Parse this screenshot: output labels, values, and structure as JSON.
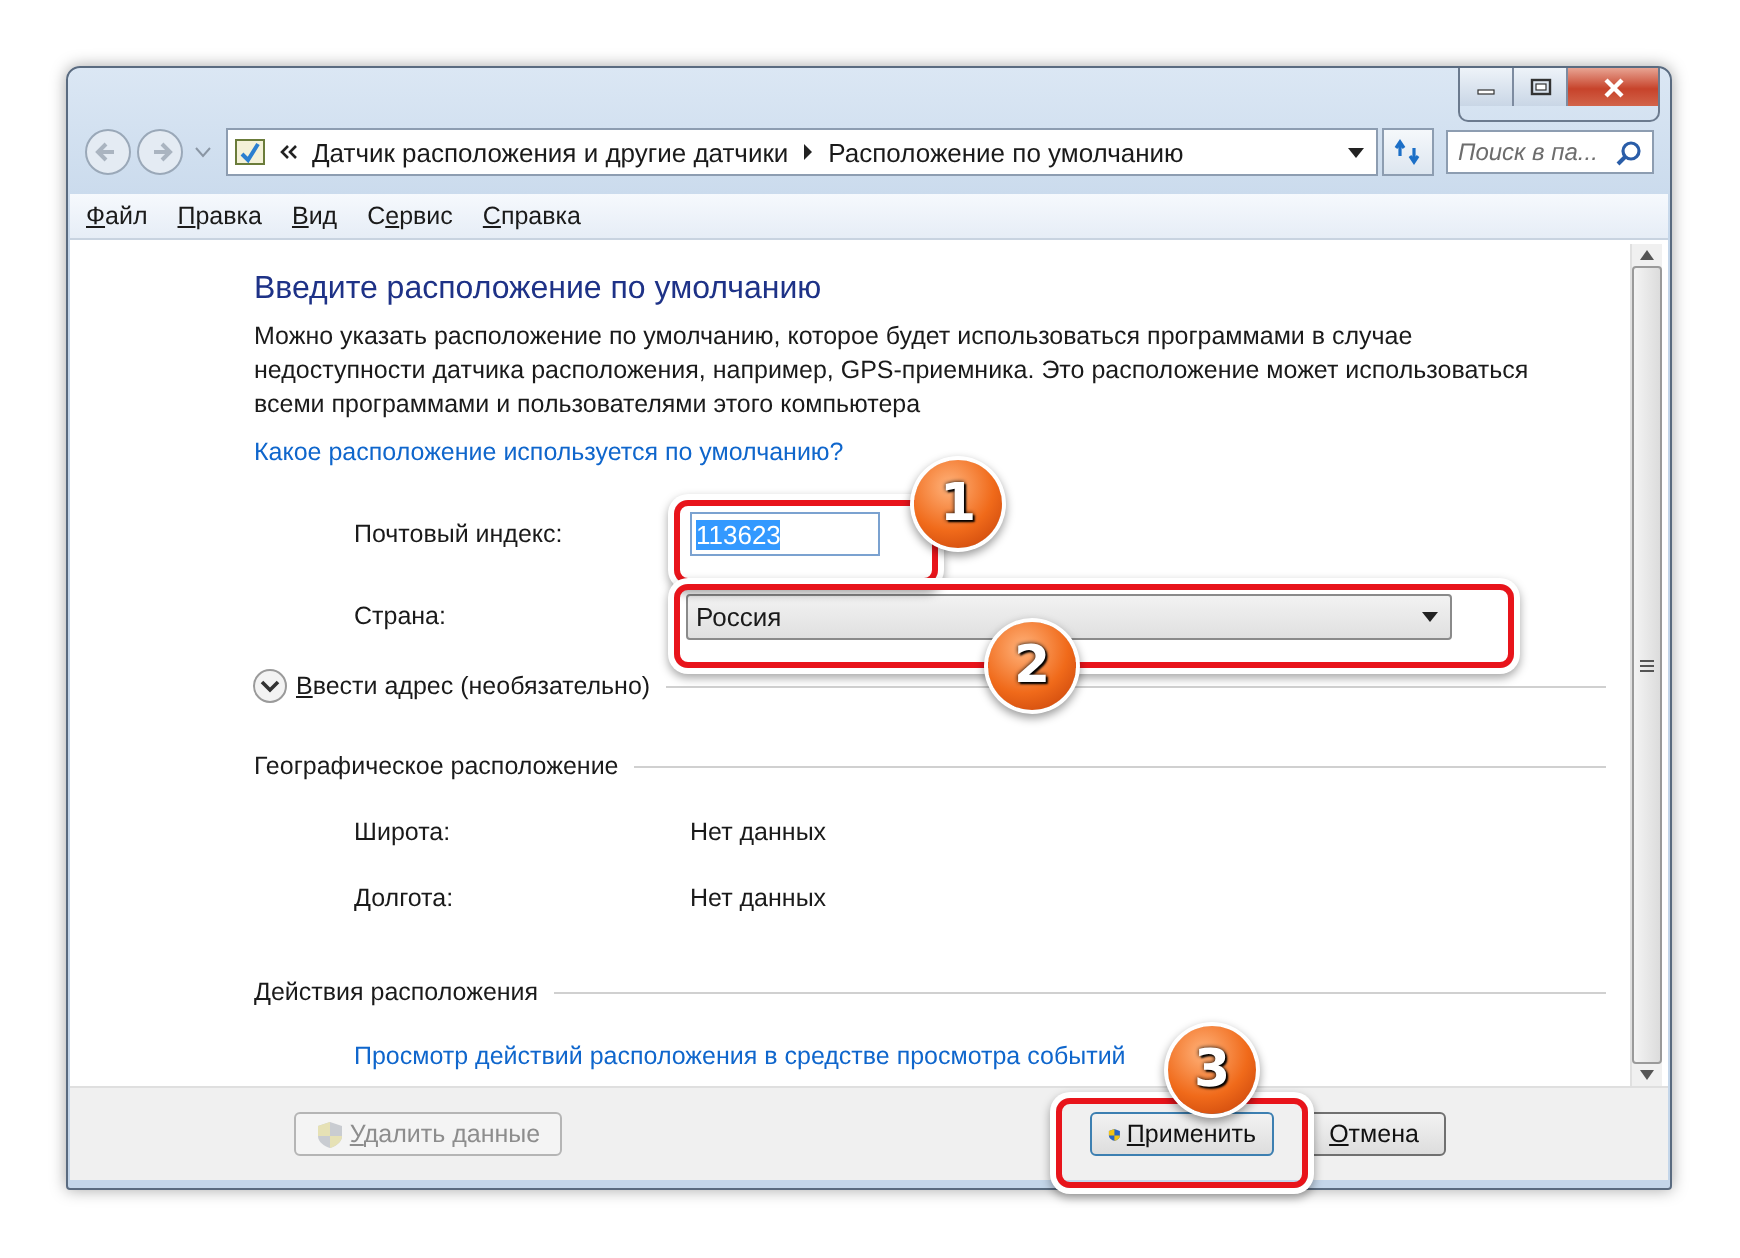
{
  "address_bar": {
    "breadcrumb": [
      "Датчик расположения и другие датчики",
      "Расположение по умолчанию"
    ],
    "search": {
      "placeholder": "Поиск в па..."
    }
  },
  "menu": [
    {
      "accel": "Ф",
      "after": "айл"
    },
    {
      "accel": "П",
      "after": "равка"
    },
    {
      "accel": "В",
      "after": "ид"
    },
    {
      "before": "С",
      "accel": "е",
      "after": "рвис"
    },
    {
      "accel": "С",
      "after": "правка"
    }
  ],
  "content": {
    "heading": "Введите расположение по умолчанию",
    "description": "Можно указать расположение по умолчанию, которое будет использоваться программами в случае недоступности датчика расположения, например, GPS-приемника. Это расположение может использоваться всеми программами и пользователями этого компьютера",
    "help_link": "Какое расположение используется по умолчанию?",
    "postal_code": {
      "label": "Почтовый индекс:",
      "value": "113623",
      "selected": true
    },
    "country": {
      "label": "Страна:",
      "value": "Россия"
    },
    "address_toggle": {
      "accel": "В",
      "after": "вести адрес (необязательно)",
      "expanded": false
    },
    "geo": {
      "title": "Географическое расположение",
      "rows": [
        {
          "label": "Широта:",
          "value": "Нет данных"
        },
        {
          "label": "Долгота:",
          "value": "Нет данных"
        }
      ]
    },
    "actions": {
      "title": "Действия расположения",
      "link": "Просмотр действий расположения в средстве просмотра событий"
    }
  },
  "buttons": [
    {
      "accel": "У",
      "after": "далить данные",
      "shield": true,
      "disabled": true
    },
    {
      "accel": "П",
      "after": "рименить",
      "shield": true,
      "disabled": false
    },
    {
      "accel": "О",
      "after": "тмена",
      "shield": false,
      "disabled": false
    }
  ],
  "callouts": [
    {
      "number": "1"
    },
    {
      "number": "2"
    },
    {
      "number": "3"
    }
  ]
}
